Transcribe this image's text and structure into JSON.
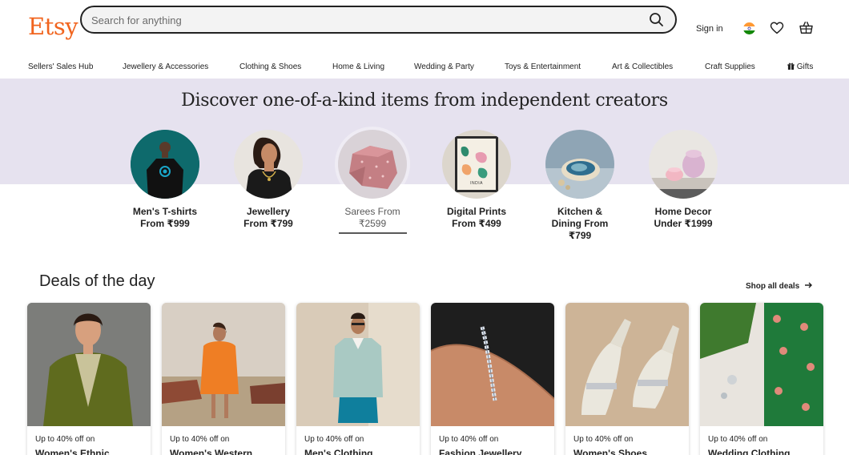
{
  "header": {
    "logo": "Etsy",
    "search_placeholder": "Search for anything",
    "sign_in": "Sign in",
    "icons": {
      "search": "search-icon",
      "flag": "india-flag-icon",
      "favorites": "heart-icon",
      "cart": "basket-icon"
    },
    "accent_color": "#f1641e"
  },
  "nav": {
    "items": [
      "Sellers' Sales Hub",
      "Jewellery & Accessories",
      "Clothing & Shoes",
      "Home & Living",
      "Wedding & Party",
      "Toys & Entertainment",
      "Art & Collectibles",
      "Craft Supplies",
      "Gifts"
    ]
  },
  "hero": {
    "title": "Discover one-of-a-kind items from independent creators",
    "band_color": "#e6e2ef",
    "categories": [
      {
        "line1": "Men's T-shirts",
        "line2": "From ₹999",
        "line3": ""
      },
      {
        "line1": "Jewellery",
        "line2": "From ₹799",
        "line3": ""
      },
      {
        "line1": "Sarees From",
        "line2": "₹2599",
        "line3": ""
      },
      {
        "line1": "Digital Prints",
        "line2": "From ₹499",
        "line3": ""
      },
      {
        "line1": "Kitchen &",
        "line2": "Dining From",
        "line3": "₹799"
      },
      {
        "line1": "Home Decor",
        "line2": "Under ₹1999",
        "line3": ""
      }
    ],
    "poster_text": "INDIA"
  },
  "deals": {
    "title": "Deals of the day",
    "shop_all": "Shop all deals",
    "cards": [
      {
        "offer": "Up to 40% off on",
        "title": "Women's Ethnic"
      },
      {
        "offer": "Up to 40% off on",
        "title": "Women's Western"
      },
      {
        "offer": "Up to 40% off on",
        "title": "Men's Clothing"
      },
      {
        "offer": "Up to 40% off on",
        "title": "Fashion Jewellery"
      },
      {
        "offer": "Up to 40% off on",
        "title": "Women's Shoes"
      },
      {
        "offer": "Up to 40% off on",
        "title": "Wedding Clothing"
      }
    ]
  }
}
